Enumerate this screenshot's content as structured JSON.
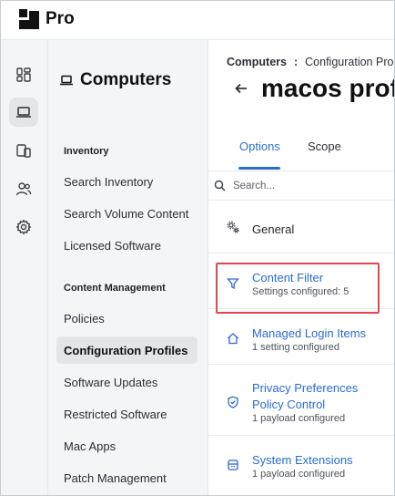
{
  "app": {
    "brand": "Pro"
  },
  "sidebar": {
    "title": "Computers",
    "sections": [
      {
        "label": "Inventory",
        "items": [
          "Search Inventory",
          "Search Volume Content",
          "Licensed Software"
        ]
      },
      {
        "label": "Content Management",
        "items": [
          "Policies",
          "Configuration Profiles",
          "Software Updates",
          "Restricted Software",
          "Mac Apps",
          "Patch Management"
        ]
      }
    ],
    "active_item": "Configuration Profiles"
  },
  "rail": {
    "icons": [
      "dashboard-icon",
      "computer-icon",
      "devices-icon",
      "users-icon",
      "settings-icon"
    ],
    "active": "computer-icon"
  },
  "breadcrumb": {
    "root": "Computers",
    "separator": ":",
    "current": "Configuration Pro"
  },
  "page": {
    "title": "macos prof"
  },
  "tabs": [
    "Options",
    "Scope"
  ],
  "active_tab": "Options",
  "search": {
    "placeholder": "Search..."
  },
  "payloads": [
    {
      "title": "General",
      "subtitle": "",
      "icon": "gears-icon"
    },
    {
      "title": "Content Filter",
      "subtitle": "Settings configured: 5",
      "icon": "filter-icon"
    },
    {
      "title": "Managed Login Items",
      "subtitle": "1 setting configured",
      "icon": "home-icon"
    },
    {
      "title": "Privacy Preferences Policy Control",
      "title_line1": "Privacy Preferences",
      "title_line2": "Policy Control",
      "subtitle": "1 payload configured",
      "icon": "shield-icon"
    },
    {
      "title": "System Extensions",
      "subtitle": "1 payload configured",
      "icon": "extension-icon"
    }
  ],
  "colors": {
    "accent": "#2c6fd3",
    "highlight": "#e0464c",
    "sidebar_bg": "#f4f5f7"
  }
}
